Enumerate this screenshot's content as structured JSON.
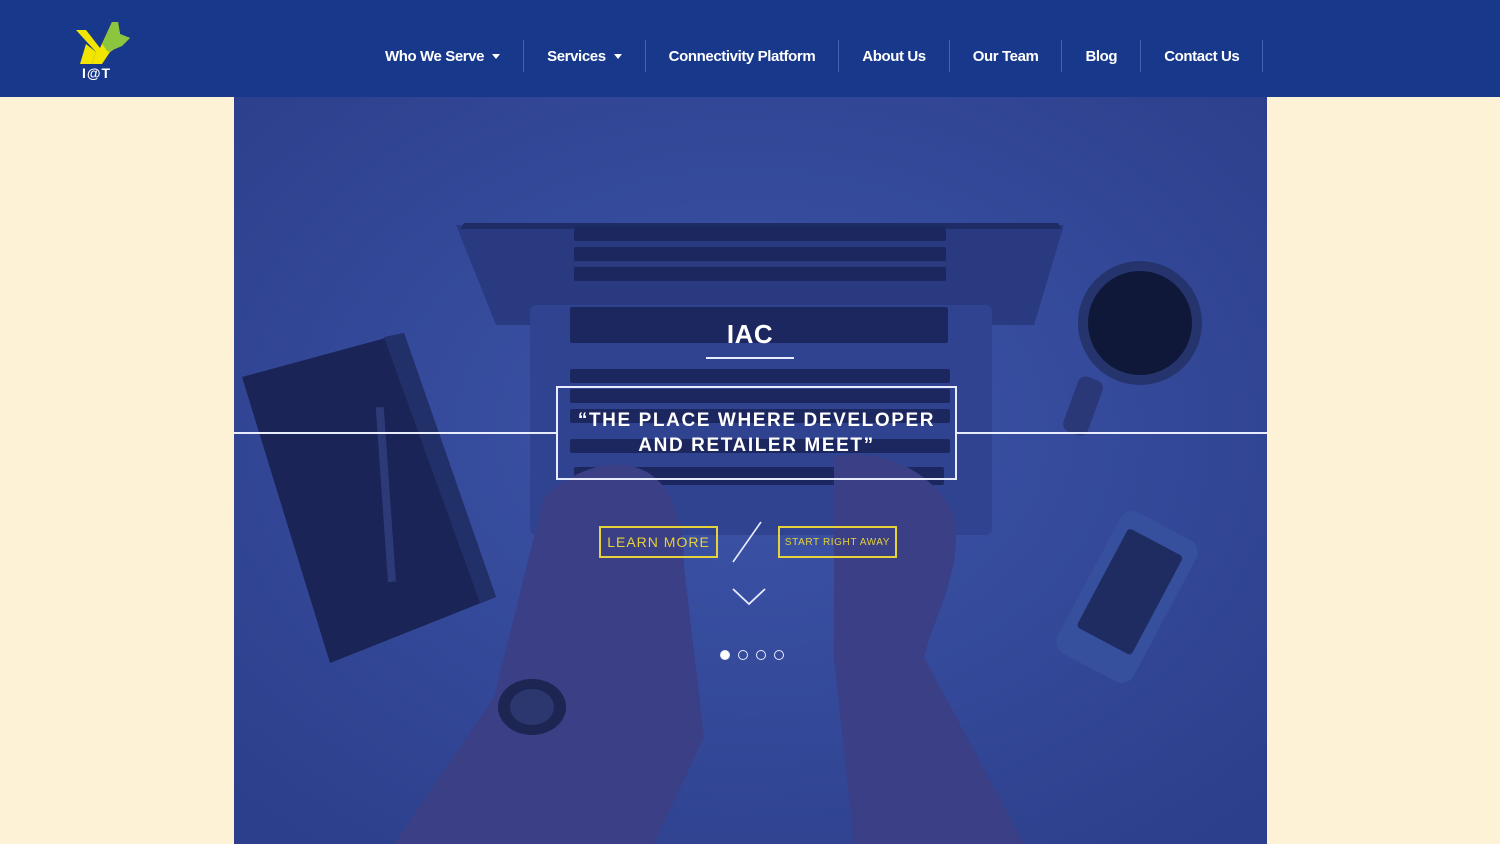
{
  "brand": {
    "logo_icon": "xl-star-logo",
    "logo_text": "I@T"
  },
  "nav": {
    "items": [
      {
        "label": "Who We Serve",
        "has_dropdown": true
      },
      {
        "label": "Services",
        "has_dropdown": true
      },
      {
        "label": "Connectivity Platform",
        "has_dropdown": false
      },
      {
        "label": "About Us",
        "has_dropdown": false
      },
      {
        "label": "Our Team",
        "has_dropdown": false
      },
      {
        "label": "Blog",
        "has_dropdown": false
      },
      {
        "label": "Contact Us",
        "has_dropdown": false
      }
    ]
  },
  "hero": {
    "title": "IAC",
    "quote": "“THE PLACE WHERE DEVELOPER AND RETAILER MEET”",
    "learn_more_label": "LEARN MORE",
    "start_label": "START RIGHT AWAY",
    "scroll_icon": "chevron-down-icon",
    "slides_total": 4,
    "active_slide": 1
  },
  "colors": {
    "header_bg": "#18388c",
    "page_bg": "#fdf1d6",
    "hero_overlay": "#33489a",
    "accent_yellow": "#e6d23a",
    "logo_green": "#8cc63f",
    "logo_yellow": "#f2e500"
  }
}
